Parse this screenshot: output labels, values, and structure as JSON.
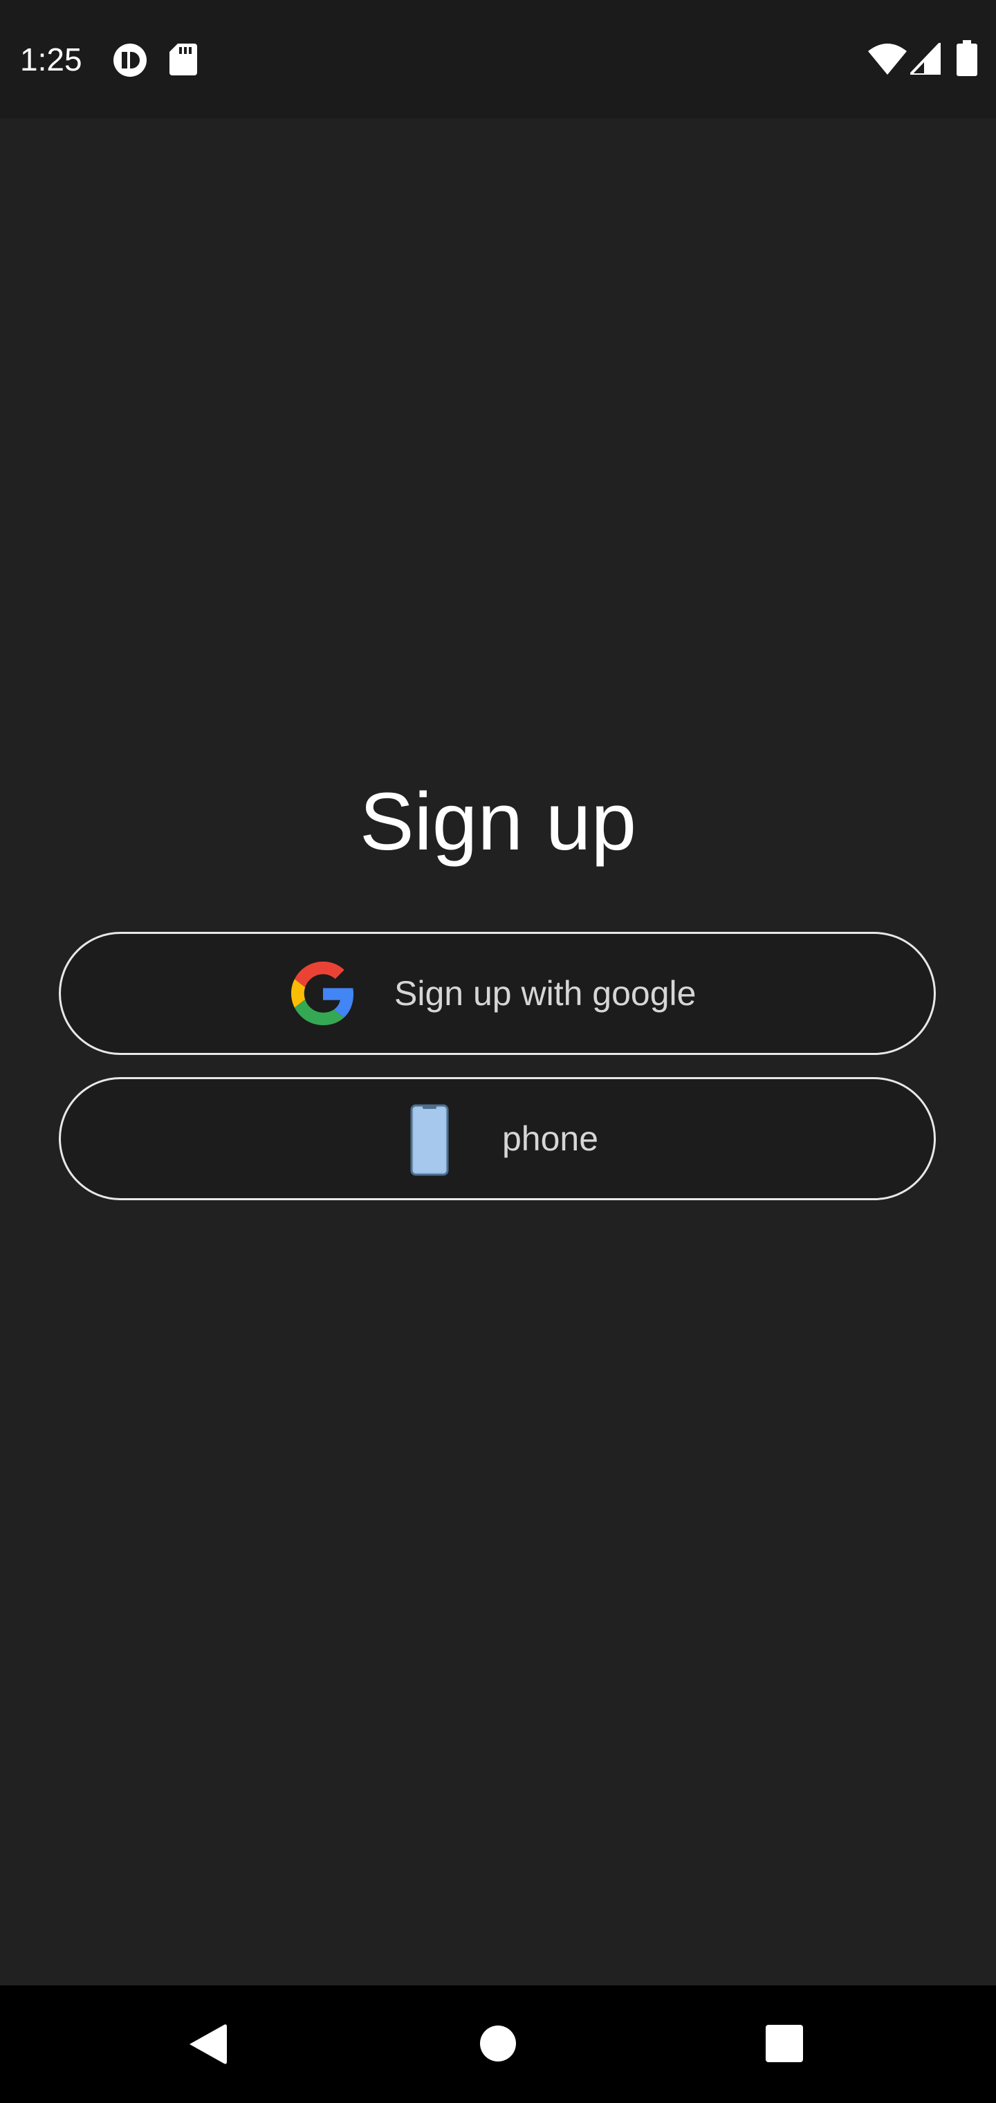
{
  "status_bar": {
    "time": "1:25",
    "left_icons": [
      "vpn-badge-icon",
      "sd-card-icon"
    ],
    "right_icons": [
      "wifi-icon",
      "cellular-signal-icon",
      "battery-icon"
    ]
  },
  "page": {
    "title": "Sign up"
  },
  "buttons": {
    "google": {
      "label": "Sign up with google",
      "icon": "google-icon"
    },
    "phone": {
      "label": "phone",
      "icon": "phone-icon"
    }
  },
  "nav_bar": {
    "items": [
      "back-icon",
      "home-icon",
      "recents-icon"
    ]
  },
  "colors": {
    "background": "#212121",
    "status_bar": "#1b1b1b",
    "button_border": "#e8e8e8",
    "phone_icon_fill": "#9fc4ea"
  }
}
